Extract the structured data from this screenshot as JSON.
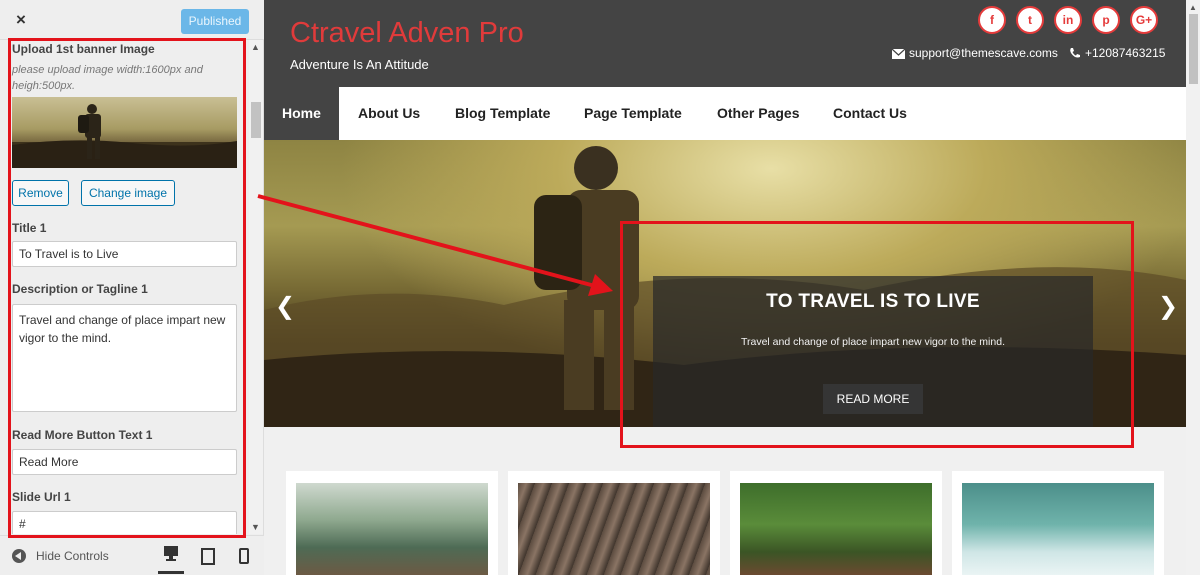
{
  "customizer": {
    "close_icon": "×",
    "published_label": "Published",
    "upload_label": "Upload 1st banner Image",
    "upload_note": "please upload image width:1600px and heigh:500px.",
    "remove_label": "Remove",
    "change_image_label": "Change image",
    "title_label": "Title 1",
    "title_value": "To Travel is to Live",
    "desc_label": "Description or Tagline 1",
    "desc_value": "Travel and change of place impart new vigor to the mind.",
    "readmore_label": "Read More Button Text 1",
    "readmore_value": "Read More",
    "slideurl_label": "Slide Url 1",
    "slideurl_value": "#",
    "hide_controls_label": "Hide Controls",
    "devices": [
      "desktop-icon",
      "tablet-icon",
      "mobile-icon"
    ]
  },
  "site": {
    "brand": "Ctravel Adven Pro",
    "tagline": "Adventure Is An Attitude",
    "social": [
      {
        "name": "facebook-icon",
        "glyph": "f"
      },
      {
        "name": "twitter-icon",
        "glyph": "t"
      },
      {
        "name": "linkedin-icon",
        "glyph": "in"
      },
      {
        "name": "pinterest-icon",
        "glyph": "p"
      },
      {
        "name": "google-plus-icon",
        "glyph": "G+"
      }
    ],
    "email": "support@themescave.coms",
    "phone": "+12087463215",
    "nav": [
      "Home",
      "About Us",
      "Blog Template",
      "Page Template",
      "Other Pages",
      "Contact Us"
    ],
    "slide": {
      "title": "TO TRAVEL IS TO LIVE",
      "description": "Travel and change of place impart new vigor to the mind.",
      "button": "READ MORE"
    },
    "colors": {
      "accent_red": "#e03b3b",
      "header_bg": "#444444",
      "annotation": "#e3131b"
    }
  }
}
